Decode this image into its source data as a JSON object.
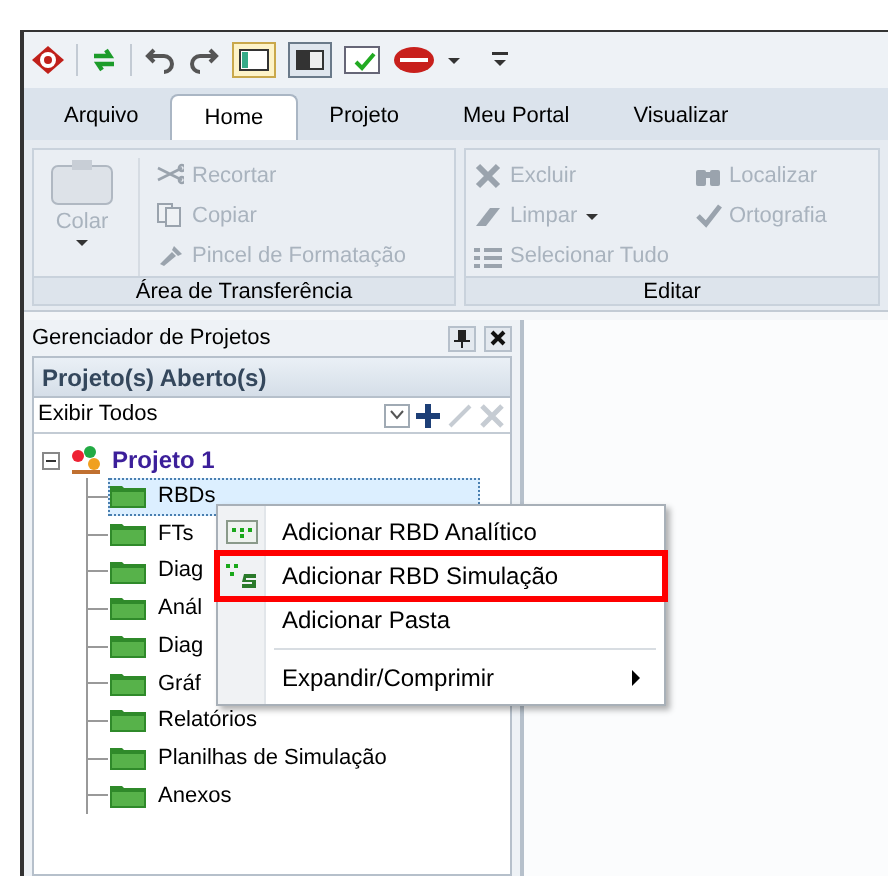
{
  "tabs": [
    {
      "label": "Arquivo",
      "selected": false
    },
    {
      "label": "Home",
      "selected": true
    },
    {
      "label": "Projeto",
      "selected": false
    },
    {
      "label": "Meu Portal",
      "selected": false
    },
    {
      "label": "Visualizar",
      "selected": false
    }
  ],
  "ribbon": {
    "groups": [
      {
        "label": "Área de Transferência",
        "large_button": {
          "label": "Colar",
          "disabled": true
        },
        "buttons": [
          {
            "kind": "cut",
            "label": "Recortar",
            "disabled": true
          },
          {
            "kind": "copy",
            "label": "Copiar",
            "disabled": true
          },
          {
            "kind": "brush",
            "label": "Pincel de Formatação",
            "disabled": true
          }
        ]
      },
      {
        "label": "Editar",
        "buttons": [
          {
            "kind": "delete",
            "label": "Excluir",
            "disabled": true
          },
          {
            "kind": "eraser",
            "label": "Limpar",
            "disabled": true,
            "dropdown": true
          },
          {
            "kind": "select",
            "label": "Selecionar Tudo",
            "disabled": true
          },
          {
            "kind": "find",
            "label": "Localizar",
            "disabled": true
          },
          {
            "kind": "spell",
            "label": "Ortografia",
            "disabled": true
          }
        ]
      }
    ]
  },
  "panel": {
    "title": "Gerenciador de Projetos",
    "section": "Projeto(s) Aberto(s)",
    "filter": "Exibir Todos",
    "tree": [
      {
        "label": "Projeto 1",
        "expanded": true,
        "children": [
          {
            "label": "RBDs",
            "selected": true
          },
          {
            "label": "FTs",
            "selected": false
          },
          {
            "label": "Diag",
            "selected": false
          },
          {
            "label": "Anál",
            "selected": false
          },
          {
            "label": "Diag",
            "selected": false
          },
          {
            "label": "Gráf",
            "selected": false
          },
          {
            "label": "Relatórios",
            "selected": false
          },
          {
            "label": "Planilhas de Simulação",
            "selected": false
          },
          {
            "label": "Anexos",
            "selected": false
          }
        ]
      }
    ]
  },
  "context_menu": {
    "items": [
      {
        "kind": "analytic",
        "label": "Adicionar RBD Analítico",
        "highlighted": false,
        "submenu": false
      },
      {
        "kind": "simulation",
        "label": "Adicionar RBD Simulação",
        "highlighted": true,
        "submenu": false
      },
      {
        "kind": "plain",
        "label": "Adicionar Pasta",
        "highlighted": false,
        "submenu": false
      },
      {
        "kind": "separator"
      },
      {
        "kind": "plain",
        "label": "Expandir/Comprimir",
        "highlighted": false,
        "submenu": true
      }
    ]
  }
}
